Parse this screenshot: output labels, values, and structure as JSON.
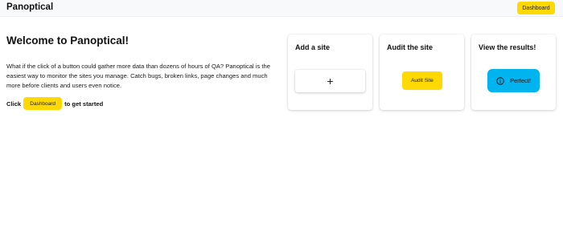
{
  "header": {
    "brand": "Panoptical",
    "dashboard_label": "Dashboard"
  },
  "welcome": {
    "title": "Welcome to Panoptical!",
    "intro": "What if the click of a button could gather more data than dozens of hours of QA? Panoptical is the easiest way to monitor the sites you manage. Catch bugs, broken links, page changes and much more before clients and users even notice.",
    "cta_prefix": "Click",
    "cta_button": "Dashboard",
    "cta_suffix": "to get started"
  },
  "cards": [
    {
      "title": "Add a site",
      "action": "+",
      "icon": "plus-icon"
    },
    {
      "title": "Audit the site",
      "action": "Audit Site"
    },
    {
      "title": "View the results!",
      "action": "Perfect!",
      "icon": "info-icon"
    }
  ],
  "colors": {
    "accent_yellow": "#ffd900",
    "result_blue": "#00b4f0"
  }
}
